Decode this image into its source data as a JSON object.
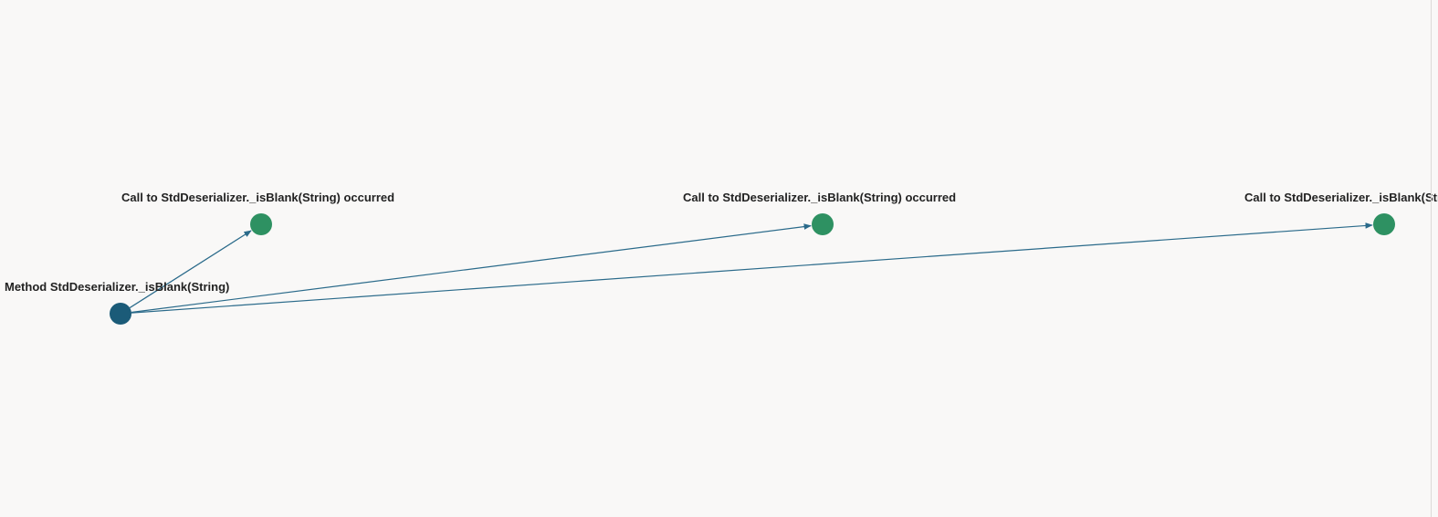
{
  "colors": {
    "background": "#f9f8f7",
    "edge": "#2a6a8a",
    "method_node": "#1b5b78",
    "call_node": "#2e9162",
    "label": "#222222"
  },
  "graph": {
    "nodes": [
      {
        "id": "method",
        "kind": "method",
        "label": "Method StdDeserializer._isBlank(String)"
      },
      {
        "id": "call1",
        "kind": "call",
        "label": "Call to StdDeserializer._isBlank(String) occurred"
      },
      {
        "id": "call2",
        "kind": "call",
        "label": "Call to StdDeserializer._isBlank(String) occurred"
      },
      {
        "id": "call3",
        "kind": "call",
        "label": "Call to StdDeserializer._isBlank(String) occurred"
      }
    ],
    "edges": [
      {
        "from": "method",
        "to": "call1"
      },
      {
        "from": "method",
        "to": "call2"
      },
      {
        "from": "method",
        "to": "call3"
      }
    ]
  }
}
